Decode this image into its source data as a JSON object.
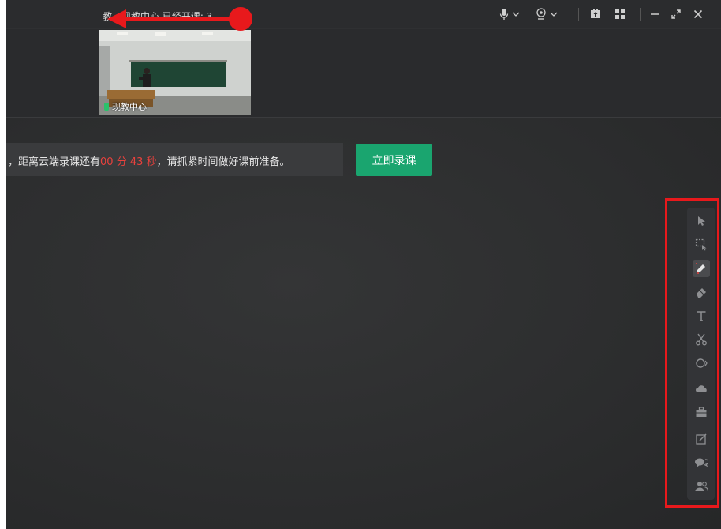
{
  "window": {
    "title": "教…现教中心 已经开课: 3…"
  },
  "titlebar_icons": [
    "microphone-icon",
    "chevron-down-icon",
    "camera-icon",
    "chevron-down-icon",
    "screen-share-icon",
    "layout-grid-icon",
    "minimize-icon",
    "expand-icon",
    "close-icon"
  ],
  "video": {
    "participant_label": "现教中心"
  },
  "notice": {
    "prefix": "，距离云端录课还有",
    "countdown": "00 分 43 秒",
    "suffix": "，请抓紧时间做好课前准备。",
    "button_label": "立即录课"
  },
  "toolbar": {
    "tools": [
      "select-icon",
      "area-select-icon",
      "pen-icon",
      "eraser-icon",
      "text-icon",
      "scissors-icon",
      "laser-pointer-icon",
      "cloud-icon",
      "toolbox-icon",
      "edit-note-icon",
      "chat-icon",
      "users-icon"
    ],
    "active_tool": "pen-icon"
  },
  "colors": {
    "accent": "#1aa56f",
    "countdown": "#e8413d",
    "annotation": "#e8191c",
    "background": "#2f3032"
  }
}
